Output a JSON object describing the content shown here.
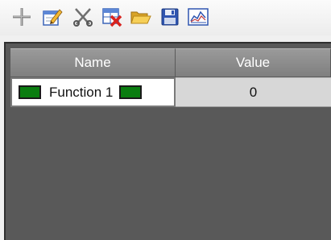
{
  "toolbar": {
    "buttons": [
      {
        "icon": "add-icon"
      },
      {
        "icon": "edit-icon"
      },
      {
        "icon": "cut-icon"
      },
      {
        "icon": "delete-table-icon"
      },
      {
        "icon": "open-folder-icon"
      },
      {
        "icon": "save-icon"
      },
      {
        "icon": "graph-icon"
      }
    ]
  },
  "table": {
    "columns": [
      "Name",
      "Value"
    ],
    "rows": [
      {
        "name": "Function 1",
        "value": "0",
        "color": "#0a7d10"
      }
    ]
  },
  "colors": {
    "panel_background": "#595959",
    "header_background": "#8c8c8c",
    "value_cell_background": "#d7d7d7",
    "function_color": "#0a7d10"
  }
}
